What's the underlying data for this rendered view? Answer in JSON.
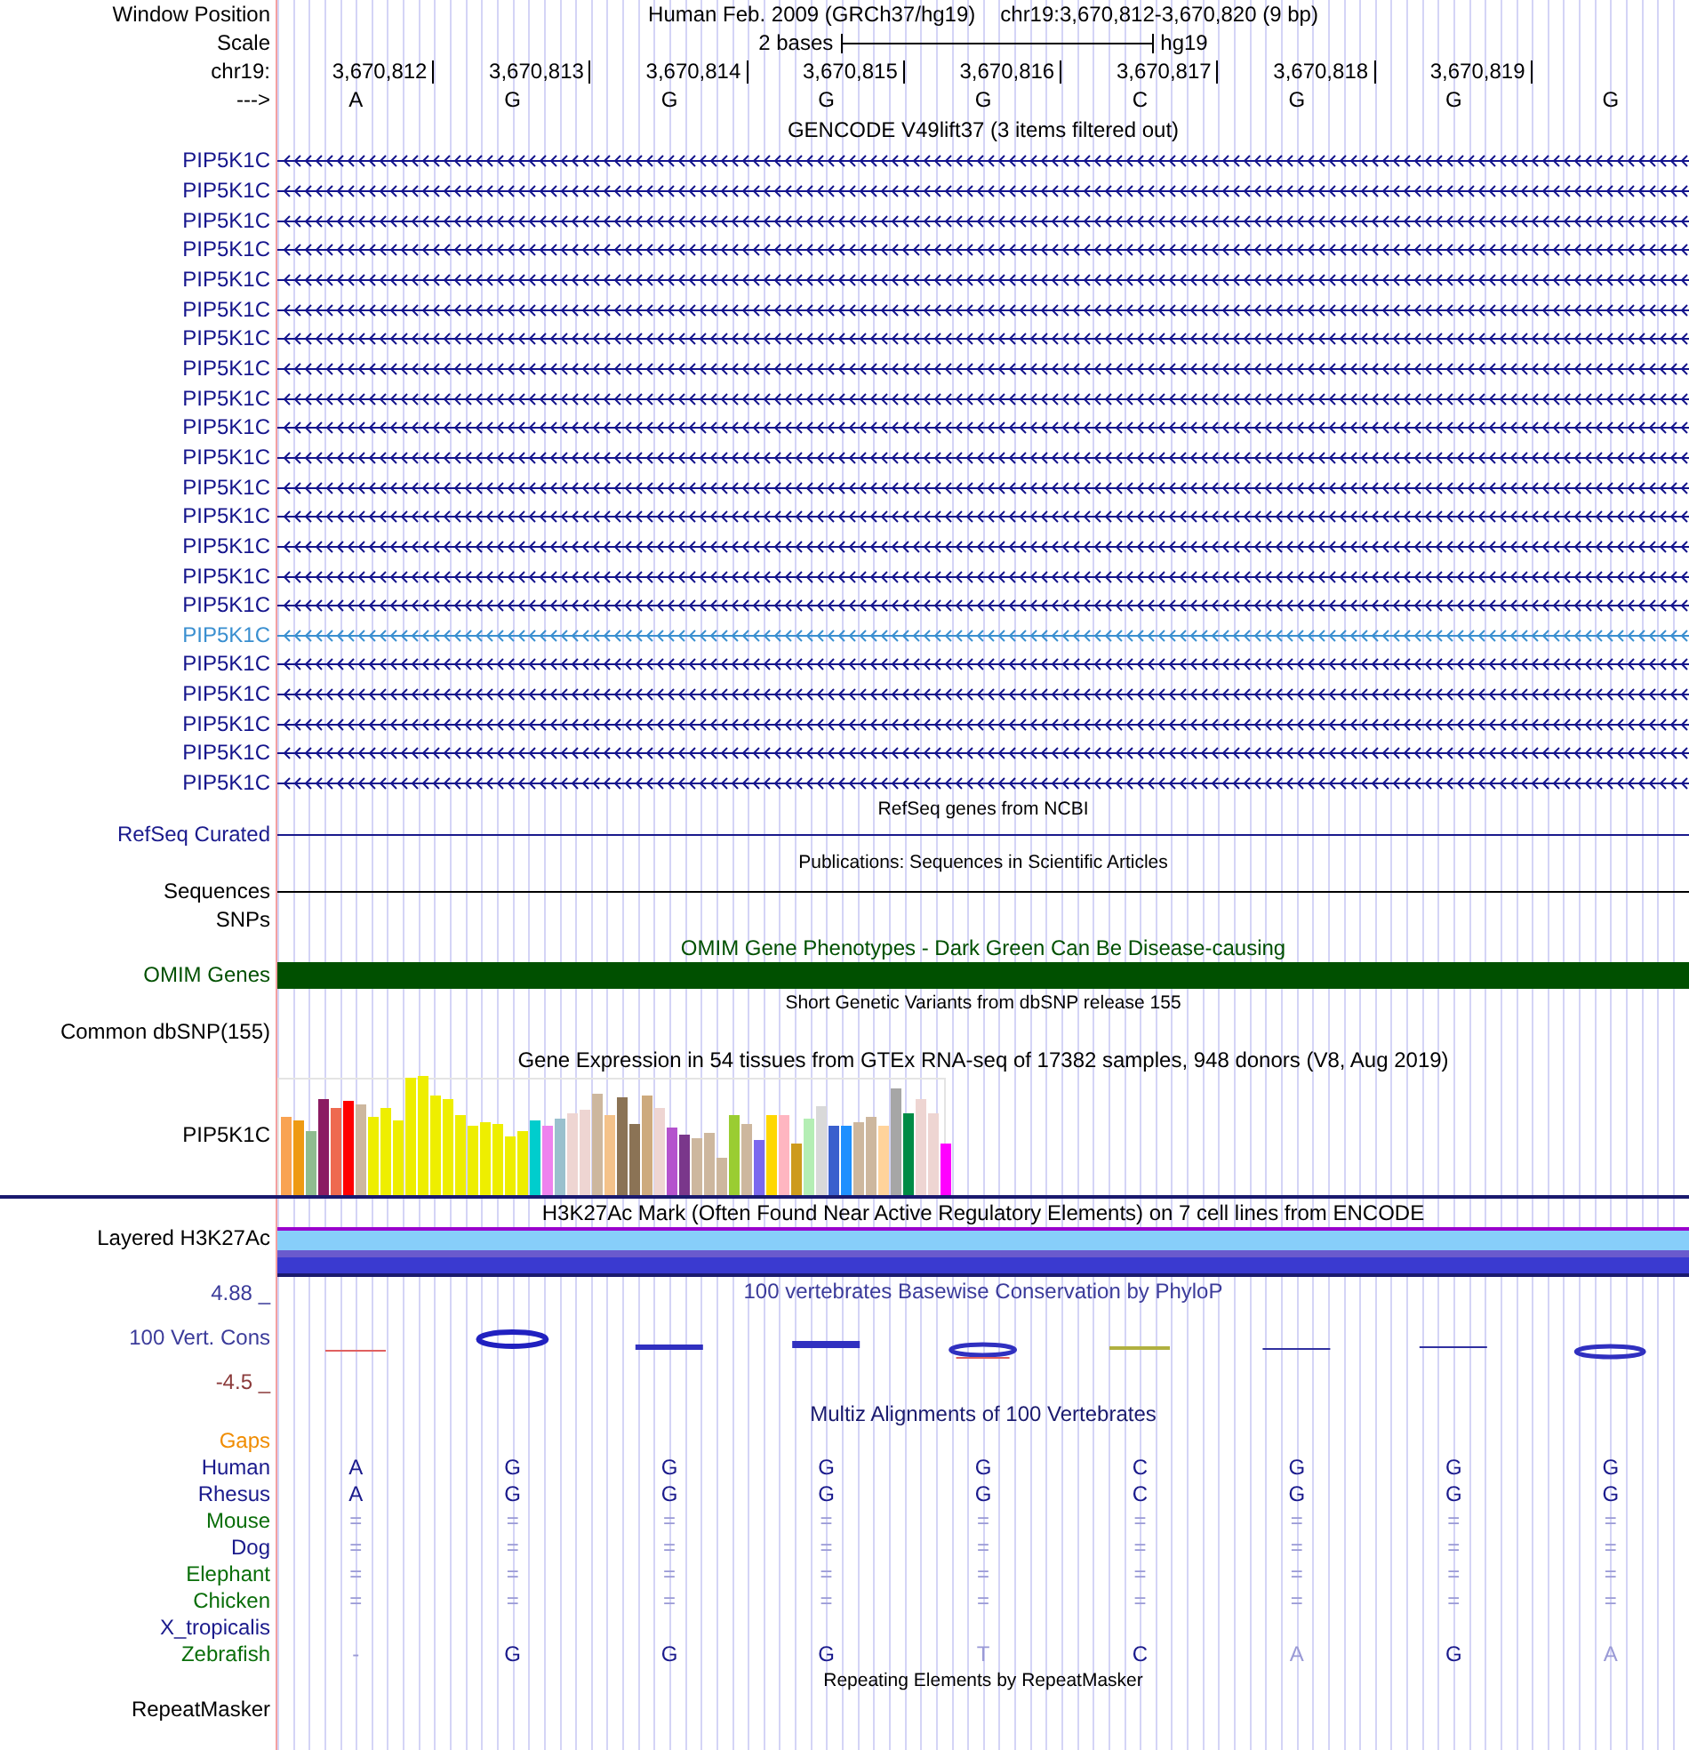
{
  "position": {
    "label": "Window Position",
    "title": "Human Feb. 2009 (GRCh37/hg19)",
    "range": "chr19:3,670,812-3,670,820 (9 bp)"
  },
  "scale": {
    "label": "Scale",
    "length": "2 bases",
    "assembly": "hg19"
  },
  "ruler": {
    "label": "chr19:",
    "ticks": [
      "3,670,812",
      "3,670,813",
      "3,670,814",
      "3,670,815",
      "3,670,816",
      "3,670,817",
      "3,670,818",
      "3,670,819"
    ]
  },
  "sequence": {
    "label": "--->",
    "bases": [
      "A",
      "G",
      "G",
      "G",
      "G",
      "C",
      "G",
      "G",
      "G"
    ]
  },
  "tracks": [
    {
      "kind": "gencode",
      "title": "GENCODE V49lift37 (3 items filtered out)",
      "items": [
        {
          "label": "PIP5K1C",
          "selected": false
        },
        {
          "label": "PIP5K1C",
          "selected": false
        },
        {
          "label": "PIP5K1C",
          "selected": false
        },
        {
          "label": "PIP5K1C",
          "selected": false
        },
        {
          "label": "PIP5K1C",
          "selected": false
        },
        {
          "label": "PIP5K1C",
          "selected": false
        },
        {
          "label": "PIP5K1C",
          "selected": false
        },
        {
          "label": "PIP5K1C",
          "selected": false
        },
        {
          "label": "PIP5K1C",
          "selected": false
        },
        {
          "label": "PIP5K1C",
          "selected": false
        },
        {
          "label": "PIP5K1C",
          "selected": false
        },
        {
          "label": "PIP5K1C",
          "selected": false
        },
        {
          "label": "PIP5K1C",
          "selected": false
        },
        {
          "label": "PIP5K1C",
          "selected": false
        },
        {
          "label": "PIP5K1C",
          "selected": false
        },
        {
          "label": "PIP5K1C",
          "selected": false
        },
        {
          "label": "PIP5K1C",
          "selected": true
        },
        {
          "label": "PIP5K1C",
          "selected": false
        },
        {
          "label": "PIP5K1C",
          "selected": false
        },
        {
          "label": "PIP5K1C",
          "selected": false
        },
        {
          "label": "PIP5K1C",
          "selected": false
        },
        {
          "label": "PIP5K1C",
          "selected": false
        }
      ]
    },
    {
      "kind": "line",
      "title": "RefSeq genes from NCBI",
      "label": "RefSeq Curated",
      "color": "#1a1a8c"
    },
    {
      "kind": "line",
      "title": "Publications: Sequences in Scientific Articles",
      "label": "Sequences",
      "color": "#000000"
    },
    {
      "kind": "label",
      "label": "SNPs",
      "color": "#000000"
    },
    {
      "kind": "bar",
      "title": "OMIM Gene Phenotypes - Dark Green Can Be Disease-causing",
      "label": "OMIM Genes",
      "color": "#005000"
    },
    {
      "kind": "blank",
      "title": "Short Genetic Variants from dbSNP release 155",
      "label": "Common dbSNP(155)",
      "color": "#000000"
    },
    {
      "kind": "gtex",
      "title": "Gene Expression in 54 tissues from GTEx RNA-seq of 17382 samples, 948 donors (V8, Aug 2019)",
      "label": "PIP5K1C",
      "color": "#000000"
    },
    {
      "kind": "layered",
      "title": "H3K27Ac Mark (Often Found Near Active Regulatory Elements) on 7 cell lines from ENCODE",
      "label": "Layered H3K27Ac",
      "color": "#000000"
    },
    {
      "kind": "conservation",
      "title": "100 vertebrates Basewise Conservation by PhyloP",
      "label": "100 Vert. Cons",
      "upper": "4.88 _",
      "lower": "-4.5 _",
      "color": "#3b3b9a"
    },
    {
      "kind": "multiz",
      "title": "Multiz Alignments of 100 Vertebrates",
      "species": [
        {
          "name": "Gaps",
          "color": "#f08c00"
        },
        {
          "name": "Human",
          "color": "#1a1a8c",
          "bases": [
            {
              "text": "A",
              "faded": false
            },
            {
              "text": "G",
              "faded": false
            },
            {
              "text": "G",
              "faded": false
            },
            {
              "text": "G",
              "faded": false
            },
            {
              "text": "G",
              "faded": false
            },
            {
              "text": "C",
              "faded": false
            },
            {
              "text": "G",
              "faded": false
            },
            {
              "text": "G",
              "faded": false
            },
            {
              "text": "G",
              "faded": false
            }
          ]
        },
        {
          "name": "Rhesus",
          "color": "#1a1a8c",
          "bases": [
            {
              "text": "A",
              "faded": false
            },
            {
              "text": "G",
              "faded": false
            },
            {
              "text": "G",
              "faded": false
            },
            {
              "text": "G",
              "faded": false
            },
            {
              "text": "G",
              "faded": false
            },
            {
              "text": "C",
              "faded": false
            },
            {
              "text": "G",
              "faded": false
            },
            {
              "text": "G",
              "faded": false
            },
            {
              "text": "G",
              "faded": false
            }
          ]
        },
        {
          "name": "Mouse",
          "color": "#0a6e0a",
          "bases": [
            {
              "text": "=",
              "faded": true
            },
            {
              "text": "=",
              "faded": true
            },
            {
              "text": "=",
              "faded": true
            },
            {
              "text": "=",
              "faded": true
            },
            {
              "text": "=",
              "faded": true
            },
            {
              "text": "=",
              "faded": true
            },
            {
              "text": "=",
              "faded": true
            },
            {
              "text": "=",
              "faded": true
            },
            {
              "text": "=",
              "faded": true
            }
          ]
        },
        {
          "name": "Dog",
          "color": "#1a1a8c",
          "bases": [
            {
              "text": "=",
              "faded": true
            },
            {
              "text": "=",
              "faded": true
            },
            {
              "text": "=",
              "faded": true
            },
            {
              "text": "=",
              "faded": true
            },
            {
              "text": "=",
              "faded": true
            },
            {
              "text": "=",
              "faded": true
            },
            {
              "text": "=",
              "faded": true
            },
            {
              "text": "=",
              "faded": true
            },
            {
              "text": "=",
              "faded": true
            }
          ]
        },
        {
          "name": "Elephant",
          "color": "#0a6e0a",
          "bases": [
            {
              "text": "=",
              "faded": true
            },
            {
              "text": "=",
              "faded": true
            },
            {
              "text": "=",
              "faded": true
            },
            {
              "text": "=",
              "faded": true
            },
            {
              "text": "=",
              "faded": true
            },
            {
              "text": "=",
              "faded": true
            },
            {
              "text": "=",
              "faded": true
            },
            {
              "text": "=",
              "faded": true
            },
            {
              "text": "=",
              "faded": true
            }
          ]
        },
        {
          "name": "Chicken",
          "color": "#0a6e0a",
          "bases": [
            {
              "text": "=",
              "faded": true
            },
            {
              "text": "=",
              "faded": true
            },
            {
              "text": "=",
              "faded": true
            },
            {
              "text": "=",
              "faded": true
            },
            {
              "text": "=",
              "faded": true
            },
            {
              "text": "=",
              "faded": true
            },
            {
              "text": "=",
              "faded": true
            },
            {
              "text": "=",
              "faded": true
            },
            {
              "text": "=",
              "faded": true
            }
          ]
        },
        {
          "name": "X_tropicalis",
          "color": "#1a1a8c"
        },
        {
          "name": "Zebrafish",
          "color": "#0a6e0a",
          "bases": [
            {
              "text": "-",
              "faded": true
            },
            {
              "text": "G",
              "faded": false
            },
            {
              "text": "G",
              "faded": false
            },
            {
              "text": "G",
              "faded": false
            },
            {
              "text": "T",
              "faded": true
            },
            {
              "text": "C",
              "faded": false
            },
            {
              "text": "A",
              "faded": true
            },
            {
              "text": "G",
              "faded": false
            },
            {
              "text": "A",
              "faded": true
            }
          ]
        }
      ]
    },
    {
      "kind": "blank",
      "title": "Repeating Elements by RepeatMasker",
      "label": "RepeatMasker",
      "color": "#000000"
    }
  ]
}
